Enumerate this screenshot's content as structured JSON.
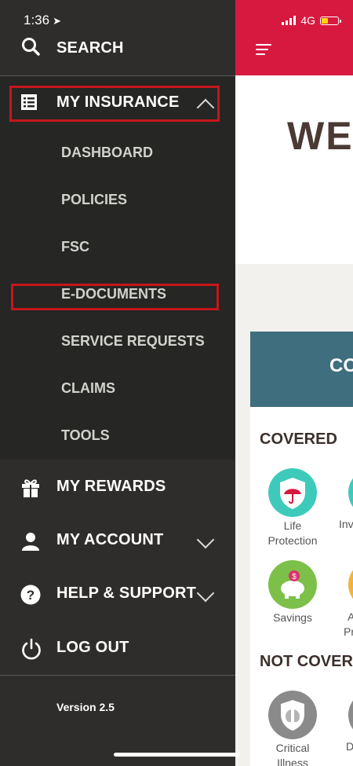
{
  "status_bar": {
    "time": "1:36",
    "network": "4G"
  },
  "menu": {
    "search": "SEARCH",
    "my_insurance": {
      "label": "MY INSURANCE",
      "items": [
        "DASHBOARD",
        "POLICIES",
        "FSC",
        "E-DOCUMENTS",
        "SERVICE REQUESTS",
        "CLAIMS",
        "TOOLS"
      ]
    },
    "my_rewards": "MY REWARDS",
    "my_account": "MY ACCOUNT",
    "help_support": "HELP & SUPPORT",
    "log_out": "LOG OUT",
    "version": "Version  2.5"
  },
  "background_app": {
    "welcome_text": "WEL",
    "coverage_header": "COV",
    "covered_label": "COVERED",
    "not_covered_label": "NOT COVERED",
    "categories": {
      "life_protection": [
        "Life",
        "Protection"
      ],
      "investment_partial": "Inv",
      "savings": "Savings",
      "a_partial": [
        "A",
        "Pr"
      ],
      "critical_illness": [
        "Critical",
        "Illness"
      ],
      "d_partial": "D"
    }
  },
  "colors": {
    "drawer_bg": "#2e2d2b",
    "submenu_bg": "#262624",
    "highlight": "#c4161c",
    "header_red": "#d7193f",
    "coverage_teal": "#3f6e7e",
    "life_teal": "#3dcabb",
    "savings_green": "#7cc04a",
    "critical_gray": "#8a8a8a"
  },
  "icons": [
    "search-icon",
    "list-icon",
    "chevron-up-icon",
    "gift-icon",
    "person-icon",
    "chevron-down-icon",
    "question-icon",
    "power-icon",
    "hamburger-icon",
    "umbrella-shield-icon",
    "piggy-bank-icon",
    "lungs-shield-icon"
  ]
}
